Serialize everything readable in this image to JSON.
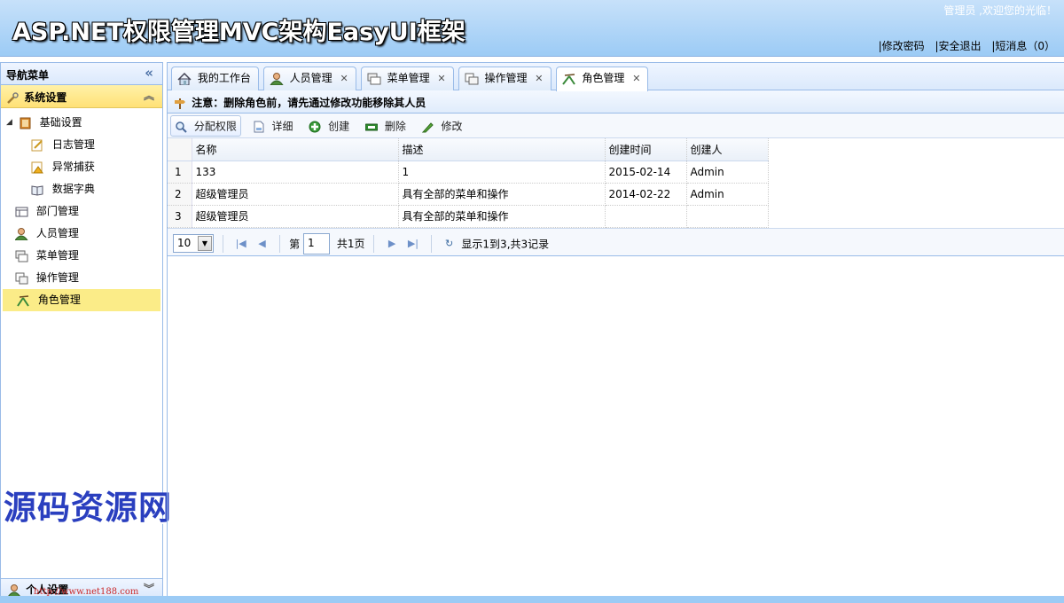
{
  "header": {
    "title": "ASP.NET权限管理MVC架构EasyUI框架",
    "welcome": "管理员 ,欢迎您的光临！",
    "links": [
      "|修改密码",
      "|安全退出",
      "|短消息（0）"
    ]
  },
  "nav": {
    "title": "导航菜单",
    "section": "系统设置",
    "items": [
      {
        "label": "基础设置",
        "icon": "book-icon"
      },
      {
        "label": "日志管理",
        "icon": "log-icon"
      },
      {
        "label": "异常捕获",
        "icon": "exception-icon"
      },
      {
        "label": "数据字典",
        "icon": "dictionary-icon"
      },
      {
        "label": "部门管理",
        "icon": "department-icon"
      },
      {
        "label": "人员管理",
        "icon": "user-icon"
      },
      {
        "label": "菜单管理",
        "icon": "menu-icon"
      },
      {
        "label": "操作管理",
        "icon": "operation-icon"
      },
      {
        "label": "角色管理",
        "icon": "role-icon"
      }
    ],
    "bottom_section": "个人设置"
  },
  "tabs": [
    {
      "label": "我的工作台",
      "icon": "home-icon"
    },
    {
      "label": "人员管理",
      "icon": "user-icon"
    },
    {
      "label": "菜单管理",
      "icon": "menu-icon"
    },
    {
      "label": "操作管理",
      "icon": "operation-icon"
    },
    {
      "label": "角色管理",
      "icon": "role-icon"
    }
  ],
  "notice": "注意：删除角色前，请先通过修改功能移除其人员",
  "toolbar": {
    "assign": "分配权限",
    "detail": "详细",
    "create": "创建",
    "delete": "删除",
    "edit": "修改"
  },
  "grid": {
    "columns": [
      "名称",
      "描述",
      "创建时间",
      "创建人"
    ],
    "rows": [
      {
        "n": "1",
        "name": "133",
        "desc": "1",
        "time": "2015-02-14",
        "creator": "Admin"
      },
      {
        "n": "2",
        "name": "超级管理员",
        "desc": "具有全部的菜单和操作",
        "time": "2014-02-22",
        "creator": "Admin"
      },
      {
        "n": "3",
        "name": "超级管理员",
        "desc": "具有全部的菜单和操作",
        "time": "",
        "creator": ""
      }
    ]
  },
  "pager": {
    "page_size": "10",
    "page_prefix": "第",
    "page": "1",
    "page_total": "共1页",
    "info": "显示1到3,共3记录"
  },
  "watermark": {
    "text": "源码资源网",
    "url": "http://www.net188.com"
  },
  "colors": {
    "header_bg": "#9ccbf5",
    "selected_bg": "#fbec88",
    "border": "#99bbe8"
  }
}
